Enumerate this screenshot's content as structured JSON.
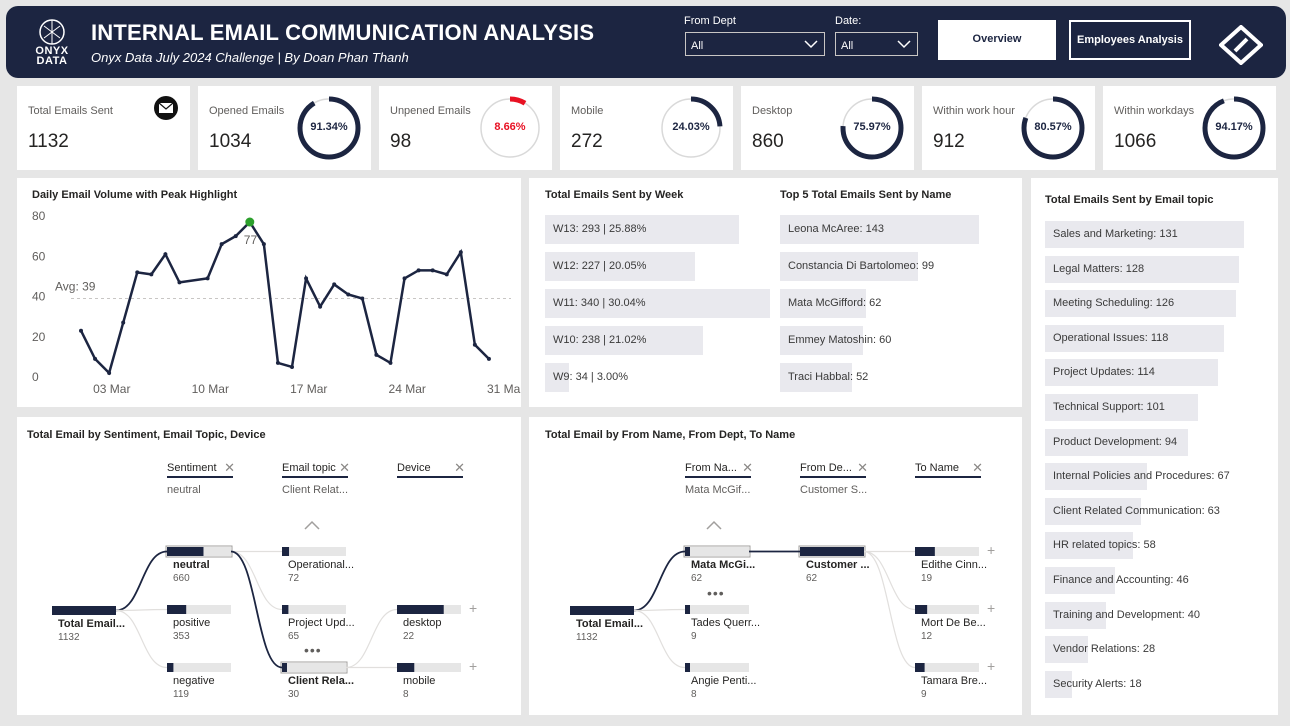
{
  "header": {
    "logo_text": [
      "ONYX",
      "DATA"
    ],
    "title": "INTERNAL EMAIL COMMUNICATION ANALYSIS",
    "subtitle": "Onyx Data July 2024 Challenge | By Doan Phan Thanh",
    "filters": [
      {
        "label": "From Dept",
        "value": "All"
      },
      {
        "label": "Date:",
        "value": "All"
      }
    ],
    "buttons": {
      "overview": "Overview",
      "employees": "Employees Analysis"
    }
  },
  "colors": {
    "navy": "#1c2541",
    "red": "#e81123",
    "bar": "#e9e9ee",
    "peak": "#2ca02c"
  },
  "kpis": [
    {
      "label": "Total Emails Sent",
      "value": "1132",
      "icon": "mail-icon"
    },
    {
      "label": "Opened Emails",
      "value": "1034",
      "pct": "91.34%",
      "frac": 0.9134,
      "color": "#1c2541"
    },
    {
      "label": "Unpened Emails",
      "value": "98",
      "pct": "8.66%",
      "frac": 0.0866,
      "color": "#e81123"
    },
    {
      "label": "Mobile",
      "value": "272",
      "pct": "24.03%",
      "frac": 0.2403,
      "color": "#1c2541"
    },
    {
      "label": "Desktop",
      "value": "860",
      "pct": "75.97%",
      "frac": 0.7597,
      "color": "#1c2541"
    },
    {
      "label": "Within work hour",
      "value": "912",
      "pct": "80.57%",
      "frac": 0.8057,
      "color": "#1c2541"
    },
    {
      "label": "Within workdays",
      "value": "1066",
      "pct": "94.17%",
      "frac": 0.9417,
      "color": "#1c2541"
    }
  ],
  "daily": {
    "title": "Daily Email Volume with Peak Highlight",
    "avg_label": "Avg: 39",
    "peak_label": "77",
    "ylim": [
      0,
      80
    ],
    "yticks": [
      "80",
      "60",
      "40",
      "20",
      "0"
    ],
    "xticks": [
      "03 Mar",
      "10 Mar",
      "17 Mar",
      "24 Mar",
      "31 Mar"
    ]
  },
  "chart_data": {
    "type": "line",
    "title": "Daily Email Volume with Peak Highlight",
    "x": [
      1,
      2,
      3,
      4,
      5,
      6,
      7,
      8,
      10,
      11,
      12,
      13,
      14,
      15,
      16,
      17,
      18,
      19,
      20,
      21,
      22,
      23,
      24,
      25,
      26,
      27,
      28,
      29,
      30,
      31
    ],
    "values": [
      23,
      9,
      2,
      27,
      52,
      51,
      61,
      47,
      49,
      66,
      70,
      77,
      66,
      7,
      5,
      49,
      35,
      46,
      41,
      39,
      11,
      7,
      49,
      53,
      53,
      51,
      62,
      16,
      9
    ],
    "avg": 39,
    "peak": {
      "x": 13,
      "value": 77
    },
    "ylim": [
      0,
      80
    ]
  },
  "week": {
    "title": "Total Emails Sent by Week",
    "items": [
      {
        "label": "W13: 293 | 25.88%",
        "value": 293
      },
      {
        "label": "W12: 227 | 20.05%",
        "value": 227
      },
      {
        "label": "W11: 340 | 30.04%",
        "value": 340
      },
      {
        "label": "W10: 238 | 21.02%",
        "value": 238
      },
      {
        "label": "W9: 34 | 3.00%",
        "value": 34
      }
    ]
  },
  "top5": {
    "title": "Top 5 Total Emails Sent by Name",
    "items": [
      {
        "label": "Leona McAree: 143",
        "value": 143
      },
      {
        "label": "Constancia Di Bartolomeo: 99",
        "value": 99
      },
      {
        "label": "Mata McGifford: 62",
        "value": 62
      },
      {
        "label": "Emmey Matoshin: 60",
        "value": 60
      },
      {
        "label": "Traci Habbal: 52",
        "value": 52
      }
    ]
  },
  "topics": {
    "title": "Total Emails Sent by Email topic",
    "items": [
      {
        "label": "Sales and Marketing: 131",
        "value": 131
      },
      {
        "label": "Legal Matters: 128",
        "value": 128
      },
      {
        "label": "Meeting Scheduling: 126",
        "value": 126
      },
      {
        "label": "Operational Issues: 118",
        "value": 118
      },
      {
        "label": "Project Updates: 114",
        "value": 114
      },
      {
        "label": "Technical Support: 101",
        "value": 101
      },
      {
        "label": "Product Development: 94",
        "value": 94
      },
      {
        "label": "Internal Policies and Procedures: 67",
        "value": 67
      },
      {
        "label": "Client Related Communication: 63",
        "value": 63
      },
      {
        "label": "HR related topics: 58",
        "value": 58
      },
      {
        "label": "Finance and Accounting: 46",
        "value": 46
      },
      {
        "label": "Training and Development: 40",
        "value": 40
      },
      {
        "label": "Vendor Relations: 28",
        "value": 28
      },
      {
        "label": "Security Alerts: 18",
        "value": 18
      }
    ]
  },
  "tree1": {
    "title": "Total Email by Sentiment, Email Topic, Device",
    "levels": [
      {
        "header": "Sentiment",
        "selected": "neutral"
      },
      {
        "header": "Email topic",
        "selected": "Client Relat..."
      },
      {
        "header": "Device",
        "selected": ""
      }
    ],
    "root": {
      "label": "Total Email...",
      "value": "1132"
    },
    "l1": [
      {
        "label": "neutral",
        "value": "660",
        "frac": 0.57
      },
      {
        "label": "positive",
        "value": "353",
        "frac": 0.3
      },
      {
        "label": "negative",
        "value": "119",
        "frac": 0.1
      }
    ],
    "l2": [
      {
        "label": "Operational...",
        "value": "72",
        "frac": 0.11
      },
      {
        "label": "Project Upd...",
        "value": "65",
        "frac": 0.1
      },
      {
        "label": "Client Rela...",
        "value": "30",
        "frac": 0.05
      }
    ],
    "l3": [
      {
        "label": "desktop",
        "value": "22",
        "frac": 0.73
      },
      {
        "label": "mobile",
        "value": "8",
        "frac": 0.27
      }
    ]
  },
  "tree2": {
    "title": "Total Email by From Name, From Dept, To Name",
    "levels": [
      {
        "header": "From Na...",
        "selected": "Mata McGif..."
      },
      {
        "header": "From De...",
        "selected": "Customer S..."
      },
      {
        "header": "To Name",
        "selected": ""
      }
    ],
    "root": {
      "label": "Total Email...",
      "value": "1132"
    },
    "l1": [
      {
        "label": "Mata McGi...",
        "value": "62",
        "frac": 0.05
      },
      {
        "label": "Tades Querr...",
        "value": "9",
        "frac": 0.01
      },
      {
        "label": "Angie Penti...",
        "value": "8",
        "frac": 0.01
      }
    ],
    "l2": [
      {
        "label": "Customer ...",
        "value": "62",
        "frac": 1.0
      }
    ],
    "l3": [
      {
        "label": "Edithe Cinn...",
        "value": "19",
        "frac": 0.31
      },
      {
        "label": "Mort De Be...",
        "value": "12",
        "frac": 0.19
      },
      {
        "label": "Tamara Bre...",
        "value": "9",
        "frac": 0.15
      }
    ]
  }
}
